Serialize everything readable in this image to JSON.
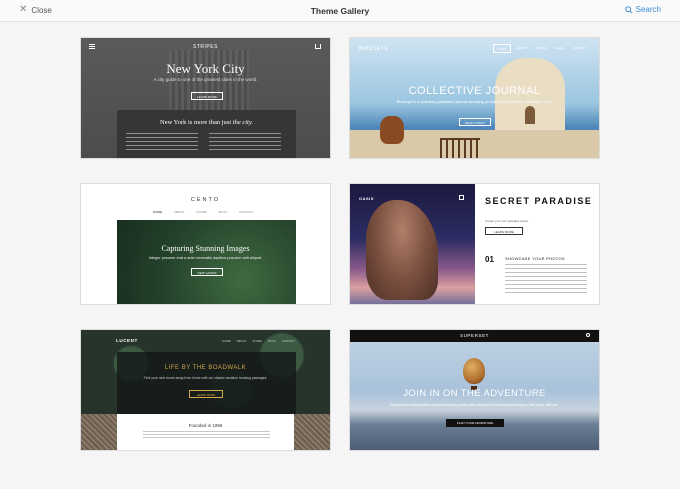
{
  "header": {
    "close_label": "Close",
    "title": "Theme Gallery",
    "search_label": "Search"
  },
  "themes": [
    {
      "brand": "STRIPES",
      "headline": "New York City",
      "subtitle": "A city guide to one of the greatest cities in the world.",
      "button": "LEARN MORE",
      "section_heading_prefix": "New York is more than just ",
      "section_heading_emph": "the city."
    },
    {
      "brand": "BIRDSEYE",
      "nav": [
        "WORK",
        "ABOUT",
        "STORE",
        "BLOG",
        "CONTACT"
      ],
      "headline": "COLLECTIVE JOURNAL",
      "subtitle": "Birdseye is a quarterly-published journal focusing on the beauty and the mundane of us.",
      "button": "READ LATEST"
    },
    {
      "brand": "CENTO",
      "nav": [
        "HOME",
        "ABOUT",
        "STORE",
        "BLOG",
        "CONTACT"
      ],
      "headline": "Capturing Stunning Images",
      "subtitle": "Integer posuere erat a ante venenatis dapibus posuere velit aliquet.",
      "button": "VIEW LATEST"
    },
    {
      "brand": "OASIS",
      "headline": "SECRET PARADISE",
      "subtitle": "Create your own paradise space.",
      "button": "LEARN MORE",
      "feature_number": "01",
      "feature_title": "SHOWCASE YOUR PHOTOS"
    },
    {
      "brand": "LUCENT",
      "nav": [
        "HOME",
        "ABOUT",
        "STORE",
        "BLOG",
        "CONTACT"
      ],
      "headline": "LIFE BY THE BOADWALK",
      "subtitle": "Find your next home away from home with our classic vacation housing packages.",
      "button": "LEARN MORE",
      "founded": "Founded in 1996"
    },
    {
      "brand": "SUPERSET",
      "headline": "JOIN IN ON THE ADVENTURE",
      "subtitle": "Superset is a independent and adventurous publication dedicated to sharing the beauty of the world with you.",
      "button": "PLAN YOUR ADVENTURE"
    }
  ],
  "colors": {
    "accent": "#3a8bd6",
    "lucent_gold": "#d4a84a"
  }
}
